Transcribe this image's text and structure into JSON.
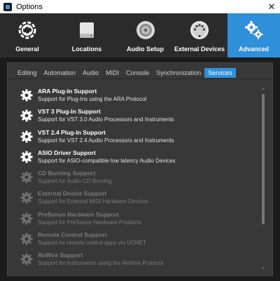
{
  "window": {
    "title": "Options",
    "close_glyph": "✕"
  },
  "categories": [
    {
      "label": "General",
      "icon": "refresh-gear-icon",
      "active": false
    },
    {
      "label": "Locations",
      "icon": "drive-icon",
      "active": false
    },
    {
      "label": "Audio Setup",
      "icon": "speaker-icon",
      "active": false
    },
    {
      "label": "External Devices",
      "icon": "midi-port-icon",
      "active": false
    },
    {
      "label": "Advanced",
      "icon": "gears-icon",
      "active": true
    }
  ],
  "tabs": [
    {
      "label": "Editing",
      "active": false
    },
    {
      "label": "Automation",
      "active": false
    },
    {
      "label": "Audio",
      "active": false
    },
    {
      "label": "MIDI",
      "active": false
    },
    {
      "label": "Console",
      "active": false
    },
    {
      "label": "Synchronization",
      "active": false
    },
    {
      "label": "Services",
      "active": true
    }
  ],
  "services": [
    {
      "name": "ARA Plug-In Support",
      "desc": "Support for Plug-Ins using the ARA Protocol",
      "enabled": true
    },
    {
      "name": "VST 3 Plug-In Support",
      "desc": "Support for VST 3.0 Audio Processors and Instruments",
      "enabled": true
    },
    {
      "name": "VST 2.4 Plug-In Support",
      "desc": "Support for VST 2.4 Audio Processors and Instruments",
      "enabled": true
    },
    {
      "name": "ASIO Driver Support",
      "desc": "Support for ASIO-compatible low latency Audio Devices",
      "enabled": true
    },
    {
      "name": "CD Burning Support",
      "desc": "Support for Audio CD Burning",
      "enabled": false
    },
    {
      "name": "External Device Support",
      "desc": "Support for External MIDI Hardware Devices",
      "enabled": false
    },
    {
      "name": "PreSonus Hardware Support",
      "desc": "Support for PreSonus Hardware Products",
      "enabled": false
    },
    {
      "name": "Remote Control Support",
      "desc": "Support for remote control apps via UCNET",
      "enabled": false
    },
    {
      "name": "ReWire Support",
      "desc": "Support for Instruments using the ReWire Protocol",
      "enabled": false
    }
  ],
  "colors": {
    "accent": "#2f8fd8",
    "enabled_gear": "#ffffff",
    "disabled_gear": "#6e6e6e"
  }
}
